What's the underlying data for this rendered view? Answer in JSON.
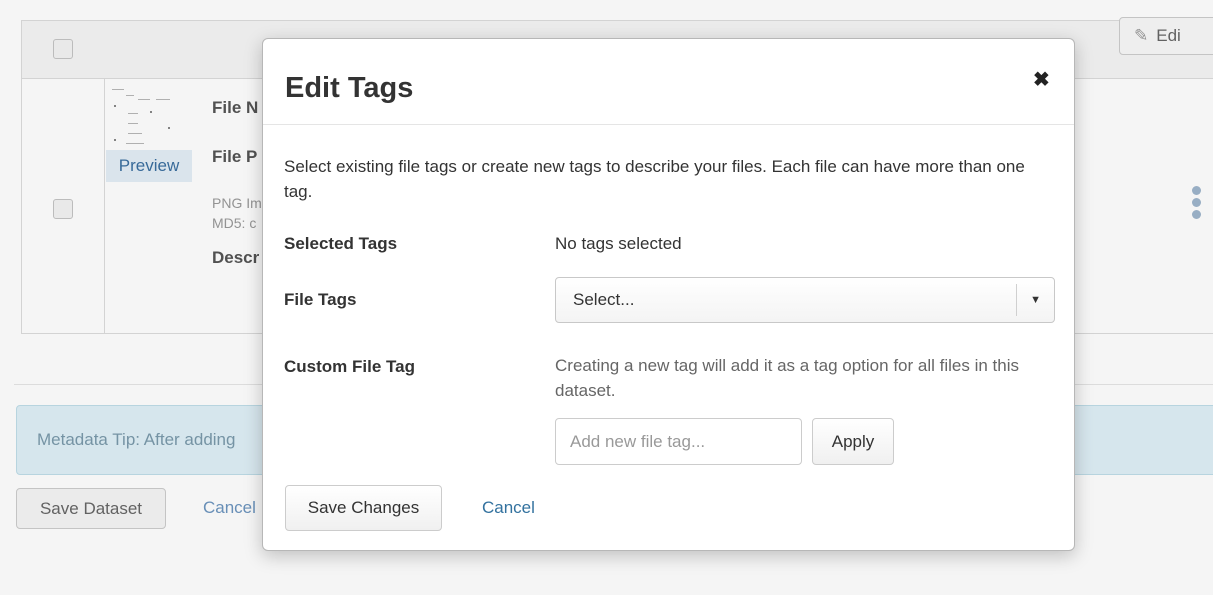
{
  "background": {
    "file": {
      "preview_label": "Preview",
      "name_label": "File N",
      "path_label": "File P",
      "type_text": "PNG Im",
      "md5_text": "MD5: c",
      "description_label": "Descr"
    },
    "edit_button_label": "Edi",
    "metadata_tip": "Metadata Tip: After adding",
    "save_dataset_label": "Save Dataset",
    "cancel_label": "Cancel"
  },
  "modal": {
    "title": "Edit Tags",
    "close_glyph": "✖",
    "intro": "Select existing file tags or create new tags to describe your files. Each file can have more than one tag.",
    "selected_tags_label": "Selected Tags",
    "selected_tags_value": "No tags selected",
    "file_tags_label": "File Tags",
    "file_tags_select_value": "Select...",
    "custom_tag_label": "Custom File Tag",
    "custom_tag_hint": "Creating a new tag will add it as a tag option for all files in this dataset.",
    "custom_tag_placeholder": "Add new file tag...",
    "apply_label": "Apply",
    "save_changes_label": "Save Changes",
    "cancel_label": "Cancel"
  },
  "icons": {
    "close": "close-icon",
    "pencil": "pencil-icon",
    "caret": "caret-down-icon",
    "kebab": "kebab-menu-icon"
  },
  "colors": {
    "link": "#33729f",
    "tip_background": "#dff0f7",
    "preview_background": "#e3eef6"
  }
}
